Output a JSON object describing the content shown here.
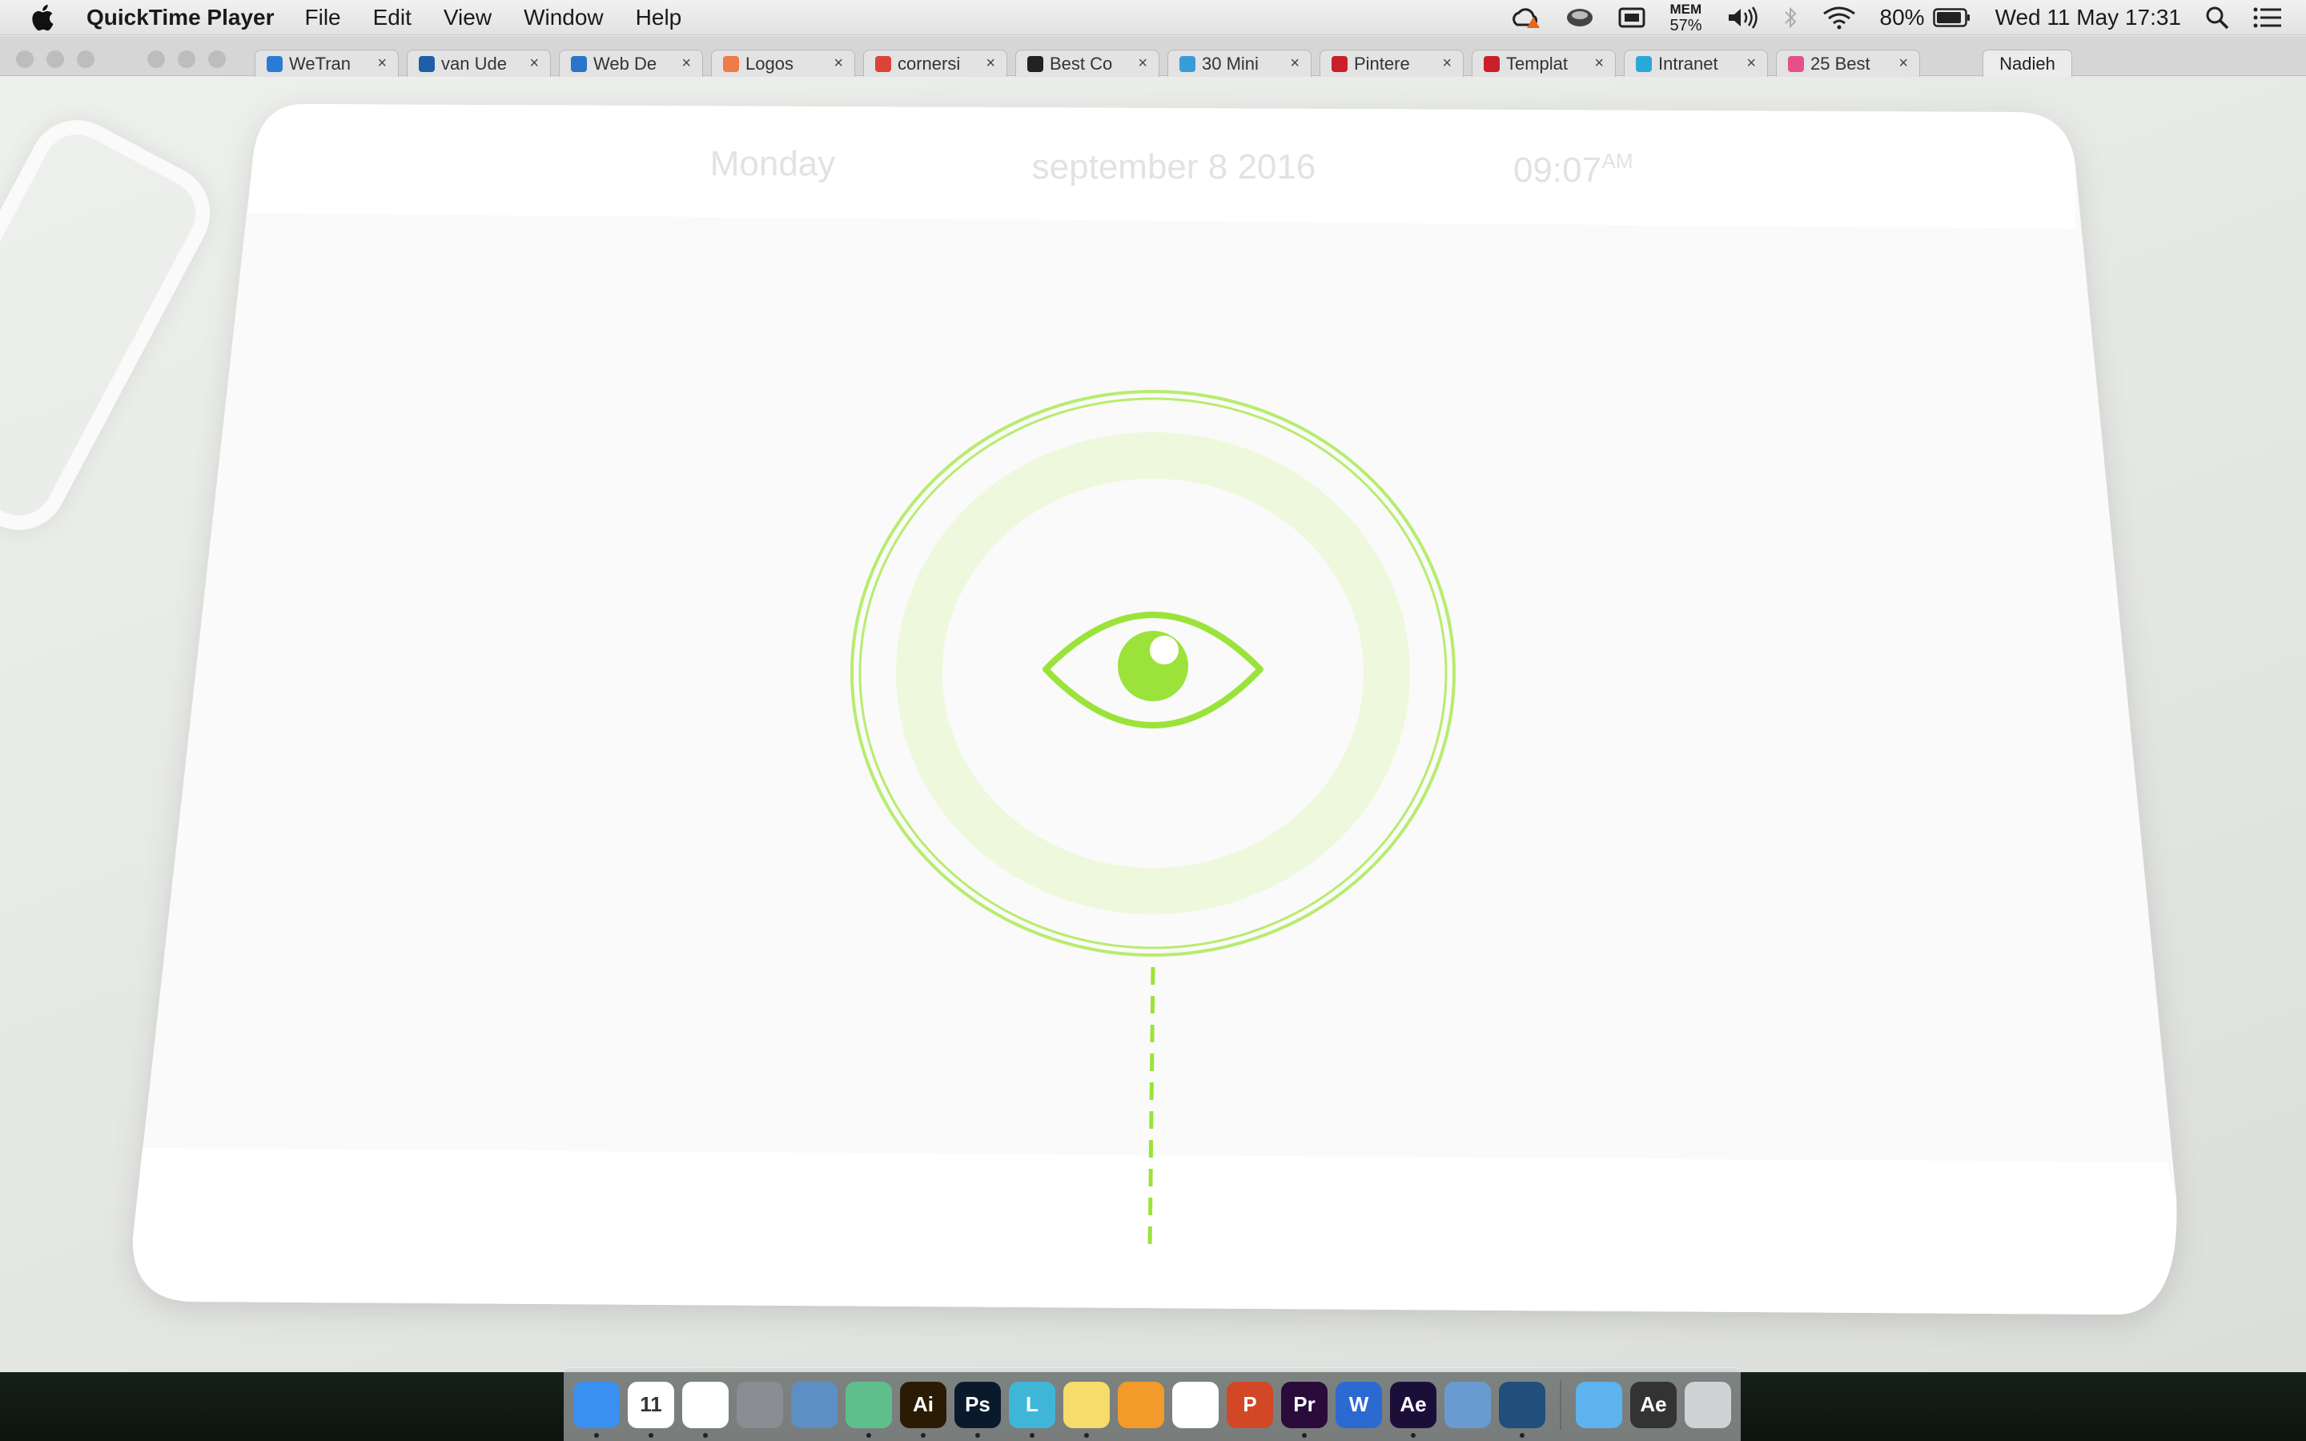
{
  "menubar": {
    "app_name": "QuickTime Player",
    "menus": [
      "File",
      "Edit",
      "View",
      "Window",
      "Help"
    ],
    "mem_label": "MEM",
    "mem_value": "57%",
    "battery": "80%",
    "datetime": "Wed 11 May  17:31"
  },
  "browser": {
    "tabs": [
      {
        "label": "WeTran",
        "color": "#2b7bd6"
      },
      {
        "label": "van Ude",
        "color": "#1f5fa8"
      },
      {
        "label": "Web De",
        "color": "#2a74c9"
      },
      {
        "label": "Logos",
        "color": "#f07a4a"
      },
      {
        "label": "cornersi",
        "color": "#db4437"
      },
      {
        "label": "Best Co",
        "color": "#222222"
      },
      {
        "label": "30 Mini",
        "color": "#3a9bd9"
      },
      {
        "label": "Pintere",
        "color": "#cb2027"
      },
      {
        "label": "Templat",
        "color": "#cb2027"
      },
      {
        "label": "Intranet",
        "color": "#2aa8d8"
      },
      {
        "label": "25 Best",
        "color": "#e5508c"
      }
    ],
    "profile": "Nadieh"
  },
  "video": {
    "day": "Monday",
    "date": "september 8 2016",
    "time": "09:07",
    "meridiem": "AM",
    "accent": "#9be33a"
  },
  "dock": {
    "apps": [
      {
        "name": "finder",
        "label": "",
        "bg": "#3b8ff0",
        "running": true
      },
      {
        "name": "calendar",
        "label": "11",
        "bg": "#ffffff",
        "running": true
      },
      {
        "name": "chrome",
        "label": "",
        "bg": "#ffffff",
        "running": true
      },
      {
        "name": "system-preferences",
        "label": "",
        "bg": "#8a8d91",
        "running": false
      },
      {
        "name": "preview-mail",
        "label": "",
        "bg": "#5d8fc4",
        "running": false
      },
      {
        "name": "atom",
        "label": "",
        "bg": "#5fbf8c",
        "running": true
      },
      {
        "name": "illustrator",
        "label": "Ai",
        "bg": "#2b1b05",
        "running": true
      },
      {
        "name": "photoshop",
        "label": "Ps",
        "bg": "#0a1a2c",
        "running": true
      },
      {
        "name": "lightpaper",
        "label": "L",
        "bg": "#3fb6d8",
        "running": true
      },
      {
        "name": "stickies",
        "label": "",
        "bg": "#f5dc6b",
        "running": true
      },
      {
        "name": "ibooks",
        "label": "",
        "bg": "#f29a2a",
        "running": false
      },
      {
        "name": "photos",
        "label": "",
        "bg": "#ffffff",
        "running": false
      },
      {
        "name": "powerpoint",
        "label": "P",
        "bg": "#d24726",
        "running": false
      },
      {
        "name": "premiere",
        "label": "Pr",
        "bg": "#2a0b3a",
        "running": true
      },
      {
        "name": "word",
        "label": "W",
        "bg": "#2b6ad1",
        "running": false
      },
      {
        "name": "after-effects",
        "label": "Ae",
        "bg": "#1b0f3a",
        "running": true
      },
      {
        "name": "preview",
        "label": "",
        "bg": "#6a9bd0",
        "running": false
      },
      {
        "name": "quicktime",
        "label": "",
        "bg": "#1f4f7a",
        "running": true
      },
      {
        "name": "downloads-folder",
        "label": "",
        "bg": "#5cb3ee",
        "running": false
      },
      {
        "name": "recent-items",
        "label": "Ae",
        "bg": "#333333",
        "running": false
      },
      {
        "name": "trash",
        "label": "",
        "bg": "#cfd3d6",
        "running": false
      }
    ]
  }
}
